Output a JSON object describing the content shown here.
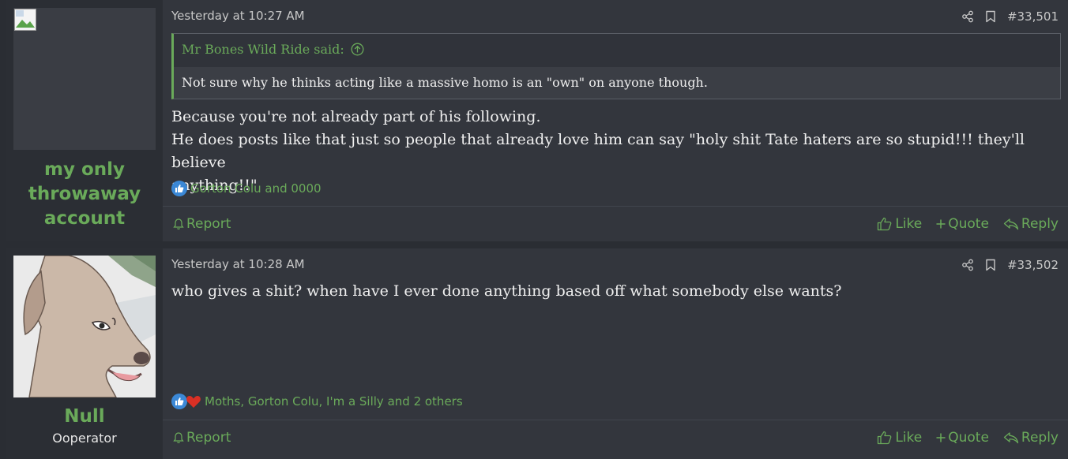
{
  "posts": [
    {
      "username": [
        "my only",
        "throwaway",
        "account"
      ],
      "user_title": "",
      "timestamp": "Yesterday at 10:27 AM",
      "post_number": "#33,501",
      "quote": {
        "author": "Mr Bones Wild Ride said:",
        "text": "Not sure why he thinks acting like a massive homo is an \"own\" on anyone though."
      },
      "message_lines": [
        "Because you're not already part of his following.",
        "He does posts like that just so people that already love him can say \"holy shit Tate haters are so stupid!!! they'll believe",
        "anything!!\""
      ],
      "reactions_text": "Gorton Colu and 0000",
      "reaction_icons": [
        "like-icon"
      ]
    },
    {
      "username": [
        "Null"
      ],
      "user_title": "Ooperator",
      "timestamp": "Yesterday at 10:28 AM",
      "post_number": "#33,502",
      "message_lines": [
        "who gives a shit? when have I ever done anything based off what somebody else wants?"
      ],
      "reactions_text": "Moths, Gorton Colu, I'm a Silly and 2 others",
      "reaction_icons": [
        "like-icon",
        "heart-icon"
      ]
    }
  ],
  "actions": {
    "report": "Report",
    "like": "Like",
    "quote": "Quote",
    "reply": "Reply"
  },
  "colors": {
    "accent": "#6aaa5a",
    "background": "#2a2d33",
    "post_bg": "#33363d",
    "like_blue": "#3b88d6",
    "heart_red": "#d93025"
  }
}
